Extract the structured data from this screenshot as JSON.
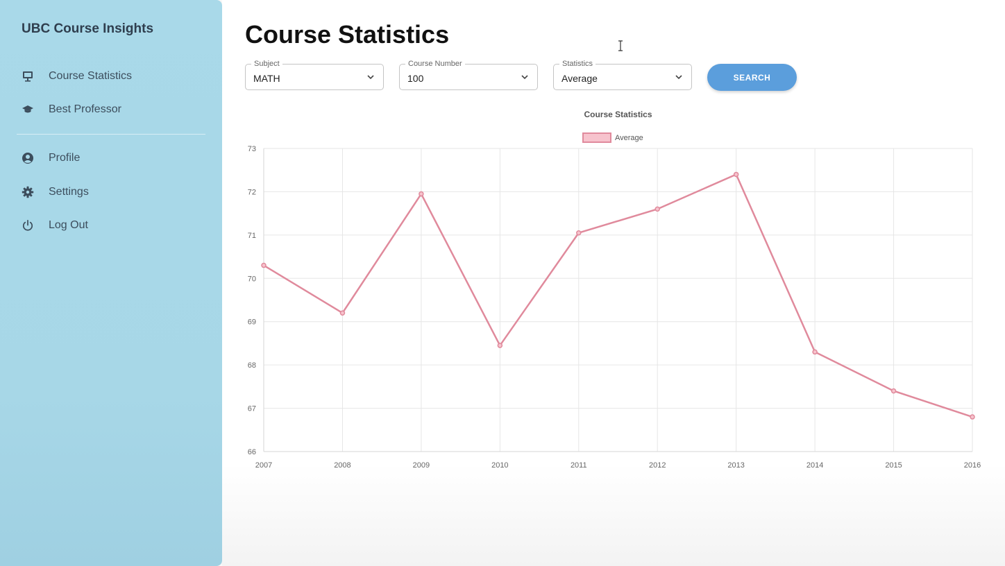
{
  "sidebar": {
    "brand": "UBC Course Insights",
    "items": [
      {
        "label": "Course Statistics",
        "icon": "presentation-icon"
      },
      {
        "label": "Best Professor",
        "icon": "graduation-cap-icon"
      },
      {
        "label": "Profile",
        "icon": "user-circle-icon"
      },
      {
        "label": "Settings",
        "icon": "gear-icon"
      },
      {
        "label": "Log Out",
        "icon": "power-icon"
      }
    ]
  },
  "main": {
    "title": "Course Statistics",
    "filters": {
      "subject": {
        "label": "Subject",
        "value": "MATH"
      },
      "course_number": {
        "label": "Course Number",
        "value": "100"
      },
      "statistics": {
        "label": "Statistics",
        "value": "Average"
      }
    },
    "search_label": "SEARCH"
  },
  "colors": {
    "sidebar_bg": "#a9d9e9",
    "accent_button": "#5b9edc",
    "series_line": "#e08a9c",
    "legend_fill": "#f7c3cd"
  },
  "chart_data": {
    "type": "line",
    "title": "Course Statistics",
    "categories": [
      "2007",
      "2008",
      "2009",
      "2010",
      "2011",
      "2012",
      "2013",
      "2014",
      "2015",
      "2016"
    ],
    "series": [
      {
        "name": "Average",
        "values": [
          70.3,
          69.2,
          71.95,
          68.45,
          71.05,
          71.6,
          72.4,
          68.3,
          67.4,
          66.8
        ]
      }
    ],
    "ylim": [
      66,
      73
    ],
    "yticks": [
      "66",
      "67",
      "68",
      "69",
      "70",
      "71",
      "72",
      "73"
    ],
    "grid": true,
    "legend": "top-center"
  }
}
